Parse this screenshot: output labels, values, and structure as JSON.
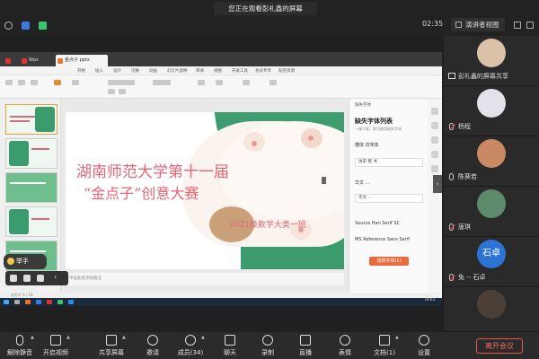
{
  "top": {
    "notice": "您正在观看彭礼鑫的屏幕",
    "time": "02:35",
    "speaker_view": "演讲者视图"
  },
  "wps": {
    "tabs": [
      "W",
      "Wps",
      "金点子.pptx"
    ],
    "menu": [
      "开始",
      "插入",
      "设计",
      "切换",
      "动画",
      "幻灯片放映",
      "审阅",
      "视图",
      "开发工具",
      "会员专享",
      "稻壳资源"
    ]
  },
  "slide": {
    "title_line1": "湖南师范大学第十一届",
    "title_line2": "“金点子”创意大赛",
    "subtitle": "2021级数学大类一班",
    "notes": "单击此处添加备注"
  },
  "right_pane": {
    "header": "缺失字体",
    "title": "缺失字体列表",
    "desc": "一键下载，即可使用缺失字体",
    "items": [
      "楷体 仿宋体",
      "华文 ...",
      "Source Han Serif SC",
      "MS Reference Sans Serif"
    ],
    "boxes": [
      "仿宋 楷 书",
      "华文 ..."
    ],
    "button": "替换字体(1)"
  },
  "status": {
    "strip": "幻灯片 1 / 11",
    "clock": "19:03"
  },
  "reaction": "举手",
  "participants": [
    {
      "name": "彭礼鑫的屏幕共享",
      "type": "share"
    },
    {
      "name": "杨程",
      "type": "user"
    },
    {
      "name": "陈葵若",
      "type": "user"
    },
    {
      "name": "唐琪",
      "type": "user"
    },
    {
      "name": "免 -- 石卓",
      "type": "user",
      "initials": "石卓"
    }
  ],
  "toolbar": {
    "items": [
      "解除静音",
      "开启视频",
      "共享屏幕",
      "邀请",
      "成员(34)",
      "聊天",
      "录制",
      "直播",
      "表情",
      "文档(1)",
      "设置"
    ],
    "leave": "离开会议"
  }
}
